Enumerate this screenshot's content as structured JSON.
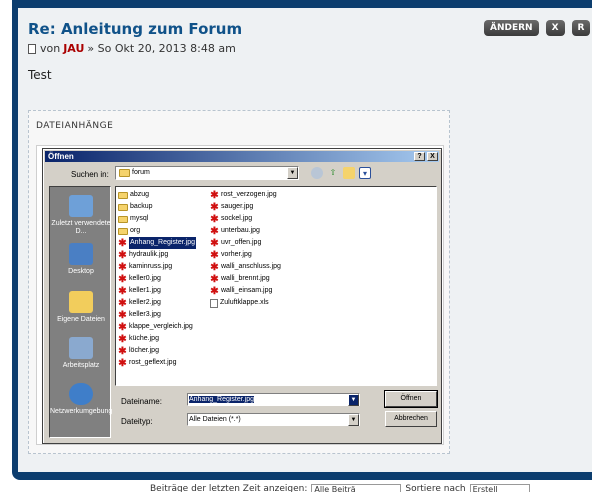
{
  "post": {
    "title": "Re: Anleitung zum Forum",
    "meta_prefix": "von",
    "author": "JAU",
    "meta_suffix": "» So Okt 20, 2013 8:48 am",
    "body": "Test",
    "actions": {
      "edit": "ÄNDERN",
      "delete": "X",
      "report": "R"
    }
  },
  "attachments": {
    "label": "DATEIANHÄNGE"
  },
  "dialog": {
    "title": "Öffnen",
    "help_btn": "?",
    "close_btn": "X",
    "lookin_label": "Suchen in:",
    "lookin_value": "forum",
    "places": [
      {
        "label": "Zuletzt verwendete D...",
        "icon": "recent-docs-icon"
      },
      {
        "label": "Desktop",
        "icon": "desktop-icon"
      },
      {
        "label": "Eigene Dateien",
        "icon": "my-documents-icon"
      },
      {
        "label": "Arbeitsplatz",
        "icon": "my-computer-icon"
      },
      {
        "label": "Netzwerkumgebung",
        "icon": "network-icon"
      }
    ],
    "files_col1": [
      {
        "name": "abzug",
        "type": "folder"
      },
      {
        "name": "backup",
        "type": "folder"
      },
      {
        "name": "mysql",
        "type": "folder"
      },
      {
        "name": "org",
        "type": "folder"
      },
      {
        "name": "Anhang_Register.jpg",
        "type": "jpg"
      },
      {
        "name": "hydraulik.jpg",
        "type": "jpg"
      },
      {
        "name": "kaminruss.jpg",
        "type": "jpg"
      },
      {
        "name": "keller0.jpg",
        "type": "jpg"
      },
      {
        "name": "keller1.jpg",
        "type": "jpg"
      },
      {
        "name": "keller2.jpg",
        "type": "jpg"
      },
      {
        "name": "keller3.jpg",
        "type": "jpg"
      },
      {
        "name": "klappe_vergleich.jpg",
        "type": "jpg"
      },
      {
        "name": "küche.jpg",
        "type": "jpg"
      },
      {
        "name": "löcher.jpg",
        "type": "jpg"
      },
      {
        "name": "rost_geflext.jpg",
        "type": "jpg"
      }
    ],
    "files_col2": [
      {
        "name": "rost_verzogen.jpg",
        "type": "jpg"
      },
      {
        "name": "sauger.jpg",
        "type": "jpg"
      },
      {
        "name": "sockel.jpg",
        "type": "jpg"
      },
      {
        "name": "unterbau.jpg",
        "type": "jpg"
      },
      {
        "name": "uvr_offen.jpg",
        "type": "jpg"
      },
      {
        "name": "vorher.jpg",
        "type": "jpg"
      },
      {
        "name": "walli_anschluss.jpg",
        "type": "jpg"
      },
      {
        "name": "walli_brennt.jpg",
        "type": "jpg"
      },
      {
        "name": "walli_einsam.jpg",
        "type": "jpg"
      },
      {
        "name": "Zuluftklappe.xls",
        "type": "xls"
      }
    ],
    "filename_label": "Dateiname:",
    "filename_value": "Anhang_Register.jpg",
    "filetype_label": "Dateityp:",
    "filetype_value": "Alle Dateien (*.*)",
    "open_btn": "Öffnen",
    "cancel_btn": "Abbrechen"
  },
  "footer": {
    "show_label": "Beiträge der letzten Zeit anzeigen:",
    "show_value": "Alle Beiträ",
    "sort_label": "Sortiere nach",
    "sort_value": "Erstell"
  },
  "colors": {
    "frame": "#0c3d6e",
    "title": "#105289",
    "author": "#aa0000"
  }
}
